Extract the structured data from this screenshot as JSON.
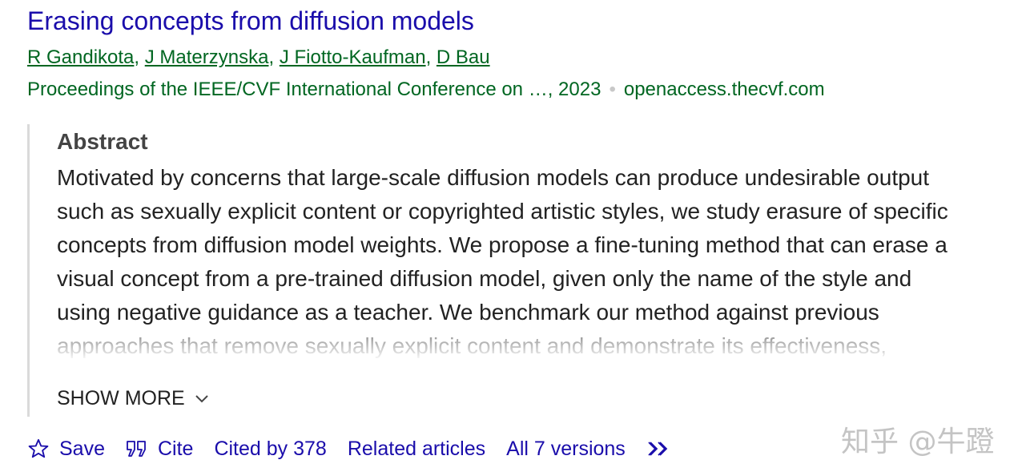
{
  "result": {
    "title": "Erasing concepts from diffusion models",
    "authors": [
      "R Gandikota",
      "J Materzynska",
      "J Fiotto-Kaufman",
      "D Bau"
    ],
    "author_separator": ", ",
    "venue": "Proceedings of the IEEE/CVF International Conference on …, 2023",
    "dot": "•",
    "source": "openaccess.thecvf.com"
  },
  "abstract": {
    "heading": "Abstract",
    "lines": [
      "Motivated by concerns that large-scale diffusion models can produce undesirable output",
      "such as sexually explicit content or copyrighted artistic styles, we study erasure of specific",
      "concepts from diffusion model weights. We propose a fine-tuning method that can erase a",
      "visual concept from a pre-trained diffusion model, given only the name of the style and",
      "using negative guidance as a teacher. We benchmark our method against previous",
      "approaches that remove sexually explicit content and demonstrate its effectiveness,"
    ],
    "show_more": "SHOW MORE"
  },
  "actions": {
    "save": "Save",
    "cite": "Cite",
    "cited_by": "Cited by 378",
    "related": "Related articles",
    "versions": "All 7 versions"
  },
  "icons": {
    "save": "star-outline-icon",
    "cite": "quote-icon",
    "more": "double-chevron-right-icon",
    "show_more": "chevron-down-icon"
  },
  "watermark": "知乎 @牛蹬",
  "colors": {
    "link": "#1a0dab",
    "green": "#006621",
    "text": "#222222",
    "abstract_border": "#dadada"
  }
}
